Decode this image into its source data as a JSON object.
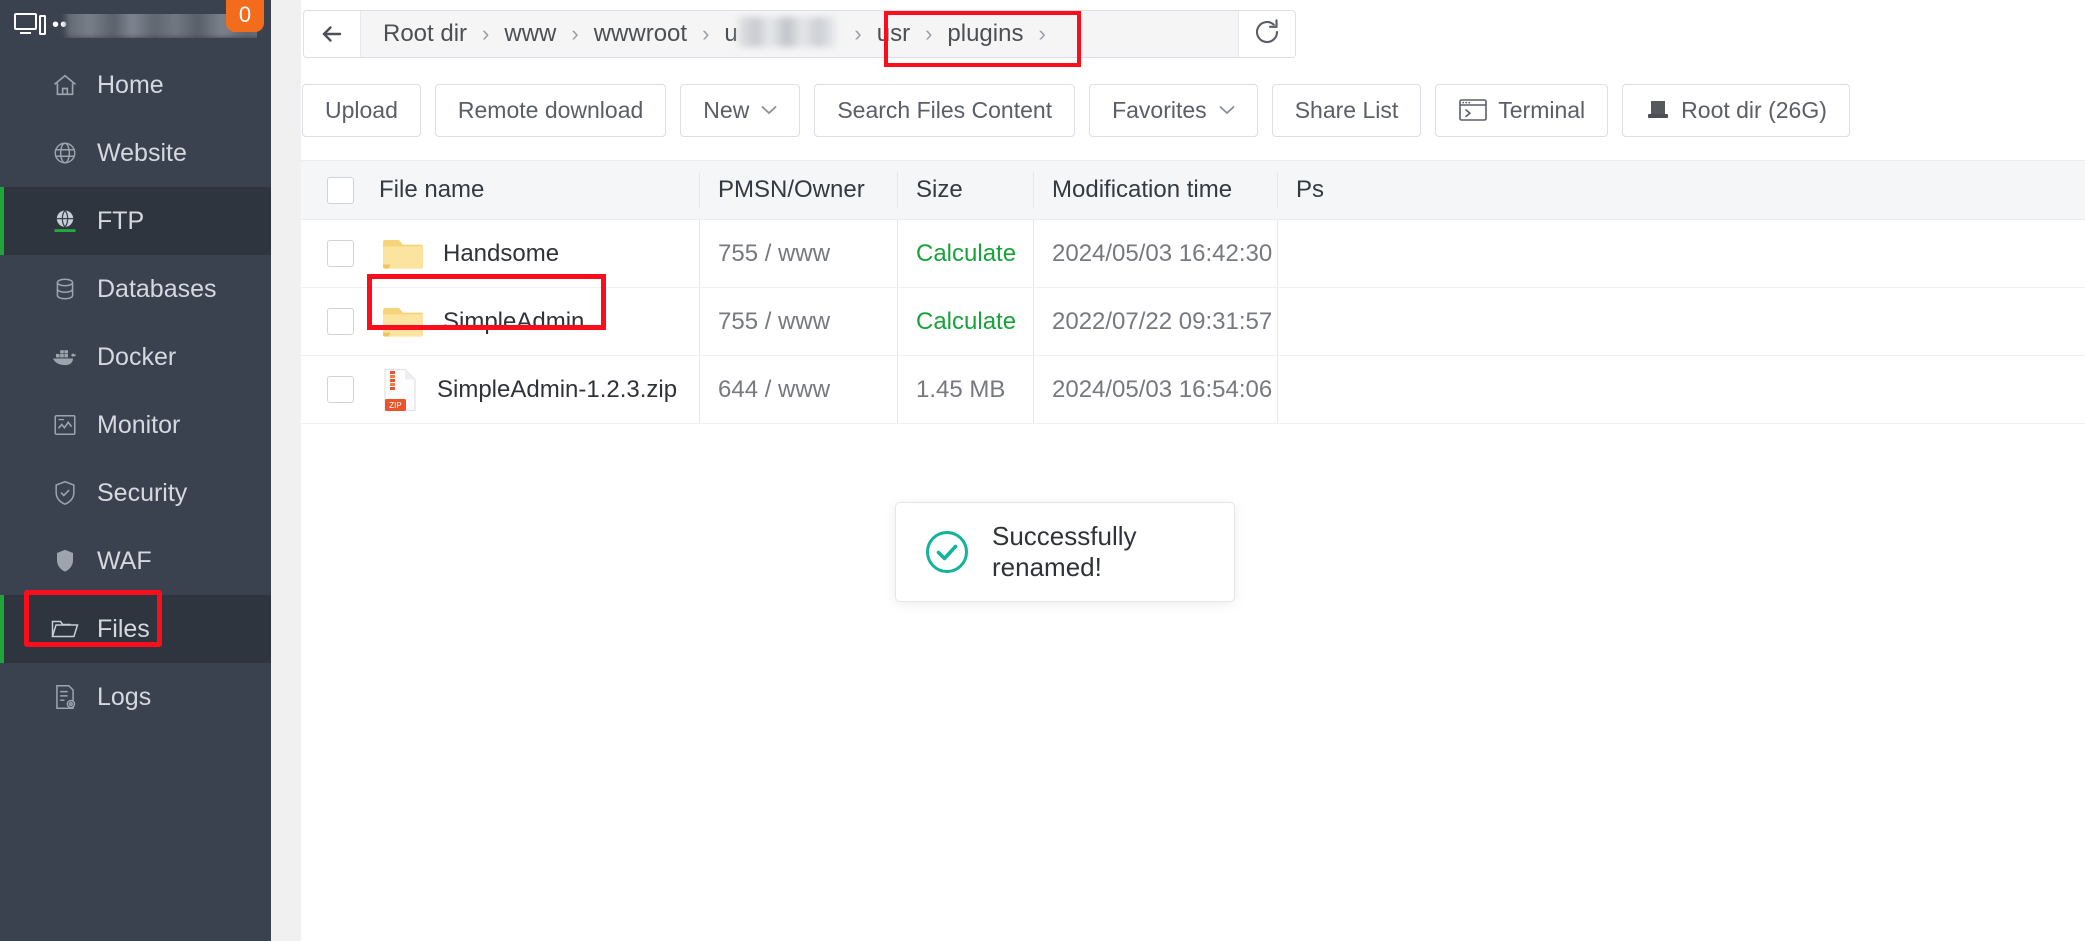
{
  "sidebar": {
    "header": {
      "icon": "monitor-server-icon",
      "redacted_label": "••",
      "badge_count": "0"
    },
    "items": [
      {
        "label": "Home",
        "icon": "home-icon",
        "active": false
      },
      {
        "label": "Website",
        "icon": "globe-icon",
        "active": false
      },
      {
        "label": "FTP",
        "icon": "ftp-globe-icon",
        "active": true
      },
      {
        "label": "Databases",
        "icon": "database-icon",
        "active": false
      },
      {
        "label": "Docker",
        "icon": "docker-icon",
        "active": false
      },
      {
        "label": "Monitor",
        "icon": "monitor-chart-icon",
        "active": false
      },
      {
        "label": "Security",
        "icon": "shield-check-icon",
        "active": false
      },
      {
        "label": "WAF",
        "icon": "shield-icon",
        "active": false
      },
      {
        "label": "Files",
        "icon": "folder-icon",
        "active": true
      },
      {
        "label": "Logs",
        "icon": "log-icon",
        "active": false
      }
    ]
  },
  "breadcrumb": {
    "back_icon": "arrow-left-icon",
    "refresh_icon": "refresh-icon",
    "separator": "›",
    "crumbs": [
      {
        "label": "Root dir",
        "redacted": false
      },
      {
        "label": "www",
        "redacted": false
      },
      {
        "label": "wwwroot",
        "redacted": false
      },
      {
        "label": "u",
        "redacted": true
      },
      {
        "label": "usr",
        "redacted": false
      },
      {
        "label": "plugins",
        "redacted": false
      }
    ],
    "highlight_color": "#fc0d1b"
  },
  "toolbar": {
    "buttons": [
      {
        "label": "Upload",
        "caret": false,
        "icon": null
      },
      {
        "label": "Remote download",
        "caret": false,
        "icon": null
      },
      {
        "label": "New",
        "caret": true,
        "icon": null
      },
      {
        "label": "Search Files Content",
        "caret": false,
        "icon": null
      },
      {
        "label": "Favorites",
        "caret": true,
        "icon": null
      },
      {
        "label": "Share List",
        "caret": false,
        "icon": null
      },
      {
        "label": "Terminal",
        "caret": false,
        "icon": "terminal-icon"
      },
      {
        "label": "Root dir (26G)",
        "caret": false,
        "icon": "disk-icon"
      }
    ]
  },
  "table": {
    "columns": [
      "File name",
      "PMSN/Owner",
      "Size",
      "Modification time",
      "Ps"
    ],
    "rows": [
      {
        "name": "Handsome",
        "icon": "folder-icon",
        "pmsn": "755 / www",
        "size": "Calculate",
        "size_is_link": true,
        "mtime": "2024/05/03 16:42:30",
        "ps": "",
        "highlighted": false
      },
      {
        "name": "SimpleAdmin",
        "icon": "folder-icon",
        "pmsn": "755 / www",
        "size": "Calculate",
        "size_is_link": true,
        "mtime": "2022/07/22 09:31:57",
        "ps": "",
        "highlighted": true
      },
      {
        "name": "SimpleAdmin-1.2.3.zip",
        "icon": "zip-file-icon",
        "pmsn": "644 / www",
        "size": "1.45 MB",
        "size_is_link": false,
        "mtime": "2024/05/03 16:54:06",
        "ps": "",
        "highlighted": false
      }
    ]
  },
  "toast": {
    "message": "Successfully renamed!",
    "icon": "success-check-circle-icon",
    "accent_color": "#13b49a"
  },
  "colors": {
    "sidebar_bg": "#3a4250",
    "sidebar_active_bg": "#2e353f",
    "sidebar_active_bar": "#20a53a",
    "badge": "#f26c1c",
    "link_green": "#19a23a",
    "highlight_red": "#fc0d1b",
    "toast_teal": "#13b49a"
  }
}
